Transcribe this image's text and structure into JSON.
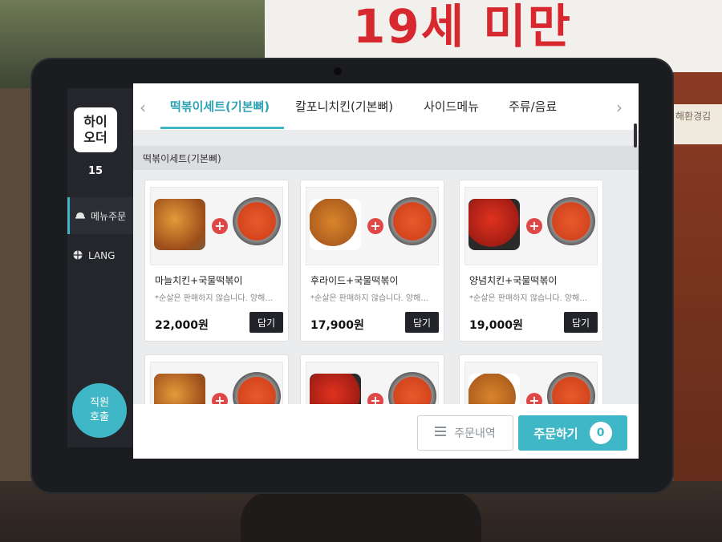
{
  "environment": {
    "wall_sign_text": "19세 미만",
    "right_sign_text": "해환경김"
  },
  "sidebar": {
    "logo_line1": "하이",
    "logo_line2": "오더",
    "table_number": "15",
    "items": [
      {
        "label": "메뉴주문",
        "icon": "bell-icon"
      },
      {
        "label": "LANG",
        "icon": "globe-icon"
      }
    ],
    "staff_call_line1": "직원",
    "staff_call_line2": "호출"
  },
  "tabs": [
    {
      "label": "떡볶이세트(기본뼈)",
      "active": true
    },
    {
      "label": "칼포니치킨(기본뼈)",
      "active": false
    },
    {
      "label": "사이드메뉴",
      "active": false
    },
    {
      "label": "주류/음료",
      "active": false
    }
  ],
  "section_title": "떡볶이세트(기본뼈)",
  "menu_items": [
    {
      "name": "마늘치킨+국물떡볶이",
      "note": "*순살은 판매하지 않습니다. 양해…",
      "price": "22,000원",
      "button": "담기"
    },
    {
      "name": "후라이드+국물떡볶이",
      "note": "*순살은 판매하지 않습니다. 양해…",
      "price": "17,900원",
      "button": "담기"
    },
    {
      "name": "양념치킨+국물떡볶이",
      "note": "*순살은 판매하지 않습니다. 양해…",
      "price": "19,000원",
      "button": "담기"
    }
  ],
  "footer": {
    "history_label": "주문내역",
    "order_label": "주문하기",
    "order_count": "0"
  },
  "colors": {
    "accent": "#3fb7c6",
    "plus_red": "#e04848",
    "button_dark": "#222429"
  }
}
